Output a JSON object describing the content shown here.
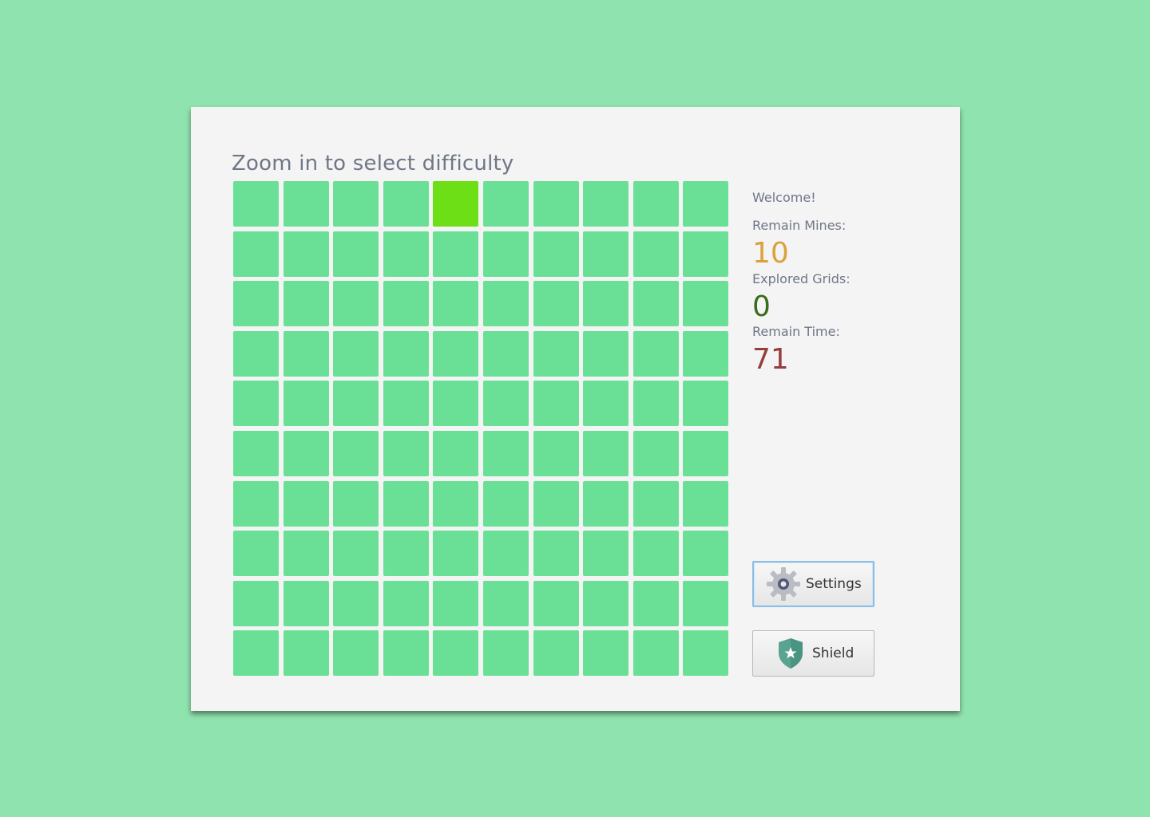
{
  "board": {
    "hint": "Zoom in to select difficulty",
    "rows": 10,
    "columns": 10,
    "highlighted_cell": {
      "row": 0,
      "col": 4
    },
    "colors": {
      "cell": "#6ae097",
      "highlight": "#6ddf17"
    }
  },
  "status": {
    "welcome": "Welcome!",
    "remain_mines_label": "Remain Mines:",
    "remain_mines_value": "10",
    "explored_grids_label": "Explored Grids:",
    "explored_grids_value": "0",
    "remain_time_label": "Remain Time:",
    "remain_time_value": "71",
    "colors": {
      "mines": "#dba13e",
      "explored": "#3b6b1c",
      "time": "#953e3e"
    }
  },
  "buttons": {
    "settings_label": "Settings",
    "settings_icon": "gear-icon",
    "shield_label": "Shield",
    "shield_icon": "shield-icon"
  }
}
